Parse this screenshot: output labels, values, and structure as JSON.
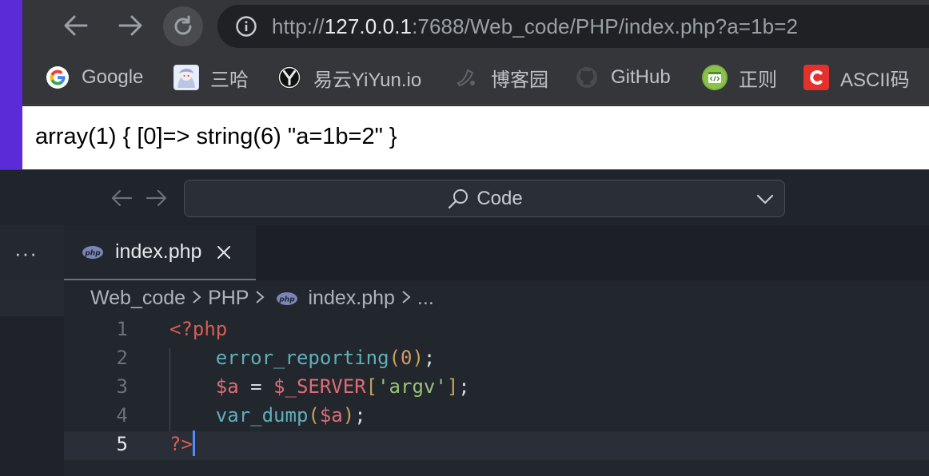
{
  "browser": {
    "url_prefix": "http://",
    "url_host": "127.0.0.1",
    "url_rest": ":7688/Web_code/PHP/index.php?a=1b=2",
    "bookmarks": [
      {
        "label": "Google",
        "icon": "google-icon"
      },
      {
        "label": "三哈",
        "icon": "anime-avatar-icon"
      },
      {
        "label": "易云YiYun.io",
        "icon": "yiyun-logo-icon"
      },
      {
        "label": "博客园",
        "icon": "cnblogs-icon"
      },
      {
        "label": "GitHub",
        "icon": "github-icon"
      },
      {
        "label": "正则",
        "icon": "regex-icon"
      },
      {
        "label": "ASCII码",
        "icon": "csdn-icon"
      }
    ],
    "page_output": "array(1) { [0]=> string(6) \"a=1b=2\" }"
  },
  "vscode": {
    "command_center_label": "Code",
    "sidebar_more": "···",
    "tab": {
      "label": "index.php",
      "icon": "php-icon"
    },
    "breadcrumb": [
      "Web_code",
      "PHP",
      "index.php",
      "..."
    ],
    "lines": [
      {
        "number": "1",
        "parts": [
          {
            "t": "<?php",
            "c": "c-tag"
          }
        ]
      },
      {
        "number": "2",
        "parts": [
          {
            "t": "    ",
            "c": "c-punc"
          },
          {
            "t": "error_reporting",
            "c": "c-fn"
          },
          {
            "t": "(",
            "c": "c-paren"
          },
          {
            "t": "0",
            "c": "c-num"
          },
          {
            "t": ")",
            "c": "c-paren"
          },
          {
            "t": ";",
            "c": "c-punc"
          }
        ]
      },
      {
        "number": "3",
        "parts": [
          {
            "t": "    ",
            "c": "c-punc"
          },
          {
            "t": "$a",
            "c": "c-var"
          },
          {
            "t": " = ",
            "c": "c-punc"
          },
          {
            "t": "$_SERVER",
            "c": "c-var"
          },
          {
            "t": "[",
            "c": "c-paren"
          },
          {
            "t": "'argv'",
            "c": "c-str"
          },
          {
            "t": "]",
            "c": "c-paren"
          },
          {
            "t": ";",
            "c": "c-punc"
          }
        ]
      },
      {
        "number": "4",
        "parts": [
          {
            "t": "    ",
            "c": "c-punc"
          },
          {
            "t": "var_dump",
            "c": "c-fn"
          },
          {
            "t": "(",
            "c": "c-paren"
          },
          {
            "t": "$a",
            "c": "c-var"
          },
          {
            "t": ")",
            "c": "c-paren"
          },
          {
            "t": ";",
            "c": "c-punc"
          }
        ]
      },
      {
        "number": "5",
        "parts": [
          {
            "t": "?>",
            "c": "c-tag"
          }
        ]
      }
    ],
    "current_line": "5"
  },
  "colors": {
    "accent_purple": "#5a2bd6",
    "cursor_blue": "#528bff",
    "php_tag_red": "#d55e55"
  }
}
